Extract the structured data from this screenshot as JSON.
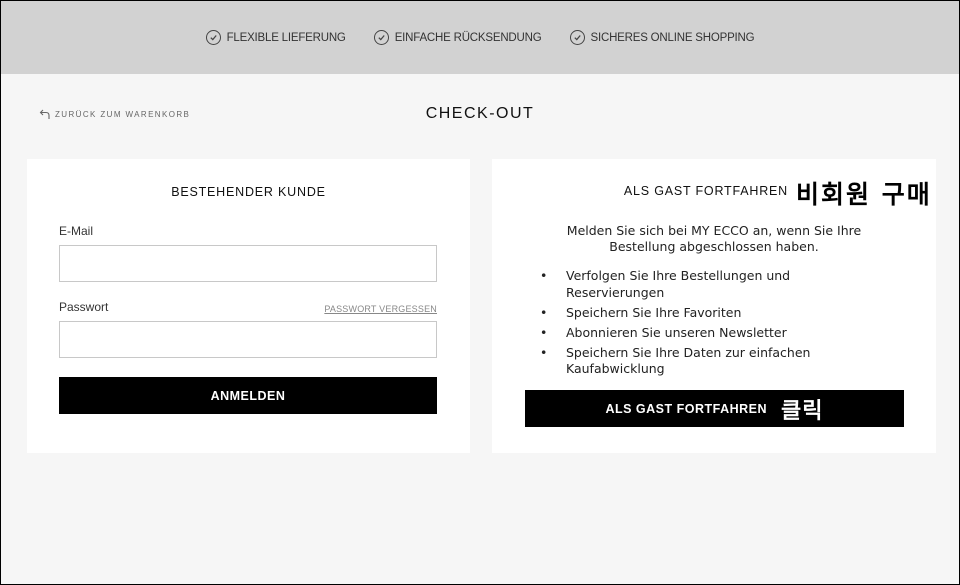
{
  "topbar": {
    "usps": [
      {
        "label": "FLEXIBLE LIEFERUNG",
        "icon": "check-circle-icon"
      },
      {
        "label": "EINFACHE RÜCKSENDUNG",
        "icon": "check-circle-icon"
      },
      {
        "label": "SICHERES ONLINE SHOPPING",
        "icon": "check-circle-icon"
      }
    ]
  },
  "header": {
    "back_label": "ZURÜCK ZUM WARENKORB",
    "title": "CHECK-OUT"
  },
  "login": {
    "heading": "BESTEHENDER KUNDE",
    "email_label": "E-Mail",
    "email_value": "",
    "password_label": "Passwort",
    "password_value": "",
    "forgot_label": "PASSWORT VERGESSEN",
    "submit_label": "ANMELDEN"
  },
  "guest": {
    "heading": "ALS GAST FORTFAHREN",
    "annotation_heading": "비회원 구매",
    "intro": "Melden Sie sich bei MY ECCO an, wenn Sie Ihre Bestellung abgeschlossen haben.",
    "benefits": [
      "Verfolgen Sie Ihre Bestellungen und Reservierungen",
      "Speichern Sie Ihre Favoriten",
      "Abonnieren Sie unseren Newsletter",
      "Speichern Sie Ihre Daten zur einfachen Kaufabwicklung"
    ],
    "button_label": "ALS GAST FORTFAHREN",
    "annotation_button": "클릭"
  },
  "colors": {
    "topbar_bg": "#d2d2d2",
    "page_bg": "#f6f6f6",
    "button_bg": "#000000"
  }
}
